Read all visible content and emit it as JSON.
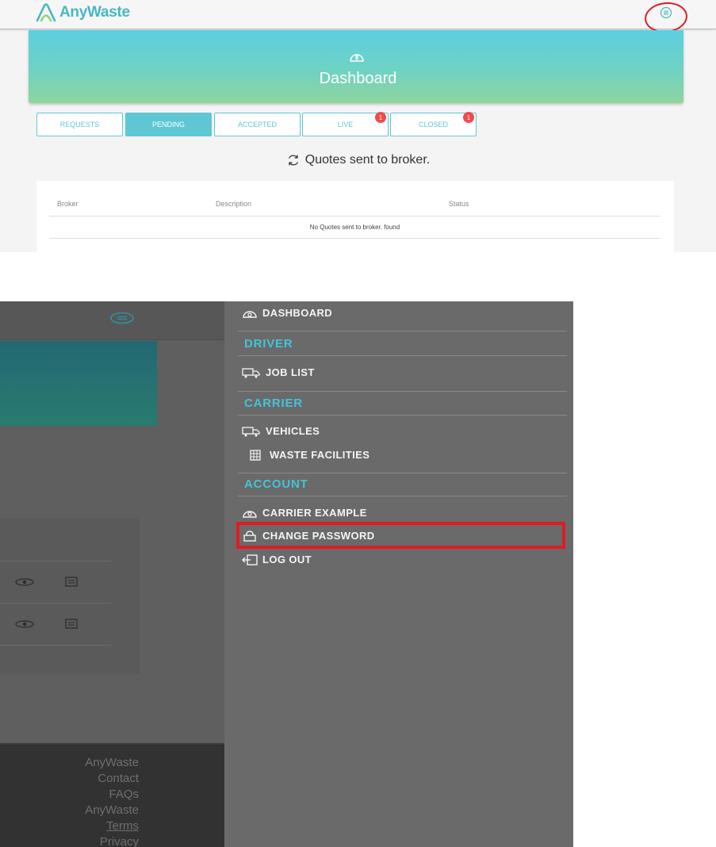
{
  "app": {
    "name": "AnyWaste",
    "brand_color": "#48b7c4",
    "accent_color": "#5fc7d4"
  },
  "header": {
    "menu_icon": "menu-circle-icon",
    "annotation": "red-circle-around-menu"
  },
  "dashboard": {
    "icon": "speedometer-icon",
    "title": "Dashboard",
    "tabs": [
      {
        "label": "REQUESTS",
        "active": false,
        "badge": ""
      },
      {
        "label": "PENDING",
        "active": true,
        "badge": ""
      },
      {
        "label": "ACCEPTED",
        "active": false,
        "badge": ""
      },
      {
        "label": "LIVE",
        "active": false,
        "badge": "1"
      },
      {
        "label": "CLOSED",
        "active": false,
        "badge": "1"
      }
    ],
    "section_heading": "Quotes sent to broker.",
    "table": {
      "columns": [
        "Broker",
        "Description",
        "Status"
      ],
      "empty_message": "No Quotes sent to broker. found"
    }
  },
  "drawer": {
    "dashboard": "DASHBOARD",
    "driver_heading": "DRIVER",
    "job_list": "JOB LIST",
    "carrier_heading": "CARRIER",
    "vehicles": "VEHICLES",
    "waste_facilities": "WASTE FACILITIES",
    "account_heading": "ACCOUNT",
    "carrier_example": "CARRIER EXAMPLE",
    "change_password": "CHANGE PASSWORD",
    "log_out": "LOG OUT",
    "heading_color": "#42c4db",
    "highlight_color": "#e01b24"
  },
  "footer": {
    "links": [
      "AnyWaste",
      "Contact",
      "FAQs",
      "AnyWaste",
      "Terms",
      "Privacy"
    ]
  }
}
